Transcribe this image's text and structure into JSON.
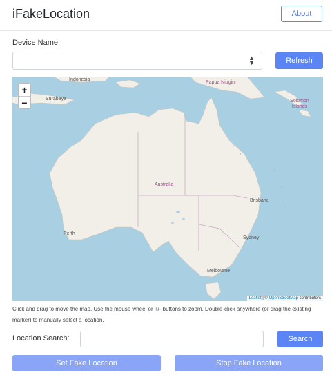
{
  "header": {
    "title": "iFakeLocation",
    "about_label": "About"
  },
  "device": {
    "label": "Device Name:",
    "selected_value": "",
    "refresh_label": "Refresh"
  },
  "map": {
    "zoom_in": "+",
    "zoom_out": "−",
    "labels": {
      "indonesia": "Indonesia",
      "surabaya": "Surabaya",
      "papua": "Papua Niugini",
      "solomon": "Solomon Islands",
      "australia": "Australia",
      "brisbane": "Brisbane",
      "perth": "Perth",
      "sydney": "Sydney",
      "melbourne": "Melbourne"
    },
    "attribution": {
      "leaflet": "Leaflet",
      "separator": " | © ",
      "osm": "OpenStreetMap",
      "suffix": " contributors"
    },
    "colors": {
      "water": "#a9cfe3",
      "land": "#f2efe9",
      "border": "#c9a9c6"
    }
  },
  "hint": "Click and drag to move the map. Use the mouse wheel or +/- buttons to zoom. Double-click anywhere (or drag the existing marker) to manually select a location.",
  "location": {
    "label": "Location Search:",
    "value": "",
    "placeholder": "",
    "search_label": "Search"
  },
  "actions": {
    "set_label": "Set Fake Location",
    "stop_label": "Stop Fake Location"
  },
  "theme": {
    "primary": "#5b84f5",
    "primary_disabled": "#8aa5f6"
  }
}
